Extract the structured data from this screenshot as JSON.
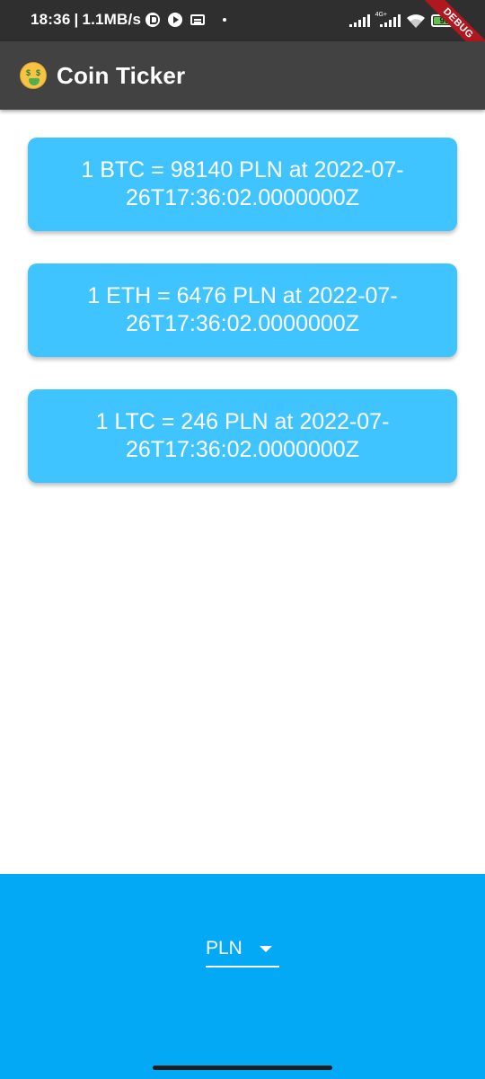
{
  "status_bar": {
    "time": "18:36",
    "separator": "|",
    "net_speed": "1.1MB/s",
    "network_label": "4G+",
    "battery_level": "90",
    "battery_fraction": 0.9,
    "icons": [
      "p-icon",
      "play-icon",
      "card-icon",
      "dot-icon",
      "signal-icon",
      "signal-4g-icon",
      "wifi-icon",
      "battery-icon"
    ]
  },
  "debug_banner": {
    "label": "DEBUG"
  },
  "app_bar": {
    "emoji_icon": "money-mouth-face-icon",
    "title": "Coin Ticker"
  },
  "rates": [
    {
      "text": "1 BTC = 98140 PLN at 2022-07-26T17:36:02.0000000Z"
    },
    {
      "text": "1 ETH = 6476 PLN at 2022-07-26T17:36:02.0000000Z"
    },
    {
      "text": "1 LTC = 246 PLN at 2022-07-26T17:36:02.0000000Z"
    }
  ],
  "currency_picker": {
    "selected": "PLN",
    "icon": "arrow-drop-down-icon"
  },
  "colors": {
    "status_bar": "#2f2f2f",
    "app_bar": "#424242",
    "card": "#40c4ff",
    "bottom_panel": "#03a9f4",
    "debug_ribbon": "#b0171f"
  }
}
